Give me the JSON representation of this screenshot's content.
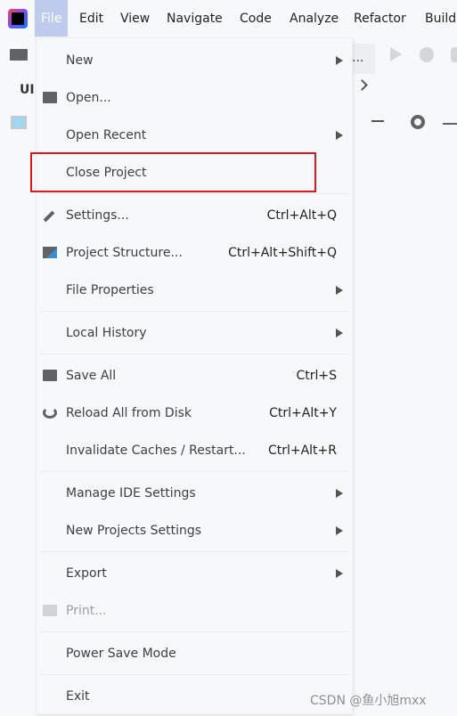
{
  "menubar": {
    "items": [
      {
        "label": "File",
        "mnemonic": "F",
        "active": true
      },
      {
        "label": "Edit",
        "mnemonic": "E"
      },
      {
        "label": "View",
        "mnemonic": "V"
      },
      {
        "label": "Navigate",
        "mnemonic": "N"
      },
      {
        "label": "Code",
        "mnemonic": "C"
      },
      {
        "label": "Analyze",
        "mnemonic": "z"
      },
      {
        "label": "Refactor",
        "mnemonic": "R"
      },
      {
        "label": "Build",
        "mnemonic": "B"
      }
    ]
  },
  "background": {
    "tab_label": "UI",
    "ellipsis": "..."
  },
  "file_menu": {
    "items": [
      {
        "label": "New",
        "mnemonic": "N",
        "submenu": true
      },
      {
        "label": "Open...",
        "mnemonic": "O",
        "icon": "folder-open-icon"
      },
      {
        "label": "Open Recent",
        "mnemonic": "R",
        "submenu": true
      },
      {
        "label": "Close Project",
        "mnemonic": "j",
        "highlighted": true
      },
      {
        "separator": true
      },
      {
        "label": "Settings...",
        "mnemonic": "t",
        "icon": "wrench-icon",
        "shortcut": "Ctrl+Alt+Q"
      },
      {
        "label": "Project Structure...",
        "icon": "project-structure-icon",
        "shortcut": "Ctrl+Alt+Shift+Q"
      },
      {
        "label": "File Properties",
        "submenu": true
      },
      {
        "separator": true
      },
      {
        "label": "Local History",
        "mnemonic": "H",
        "submenu": true
      },
      {
        "separator": true
      },
      {
        "label": "Save All",
        "mnemonic": "S",
        "icon": "save-icon",
        "shortcut": "Ctrl+S"
      },
      {
        "label": "Reload All from Disk",
        "icon": "reload-icon",
        "shortcut": "Ctrl+Alt+Y"
      },
      {
        "label": "Invalidate Caches / Restart...",
        "shortcut": "Ctrl+Alt+R"
      },
      {
        "separator": true
      },
      {
        "label": "Manage IDE Settings",
        "submenu": true
      },
      {
        "label": "New Projects Settings",
        "submenu": true
      },
      {
        "separator": true
      },
      {
        "label": "Export",
        "submenu": true
      },
      {
        "label": "Print...",
        "mnemonic": "P",
        "icon": "print-icon",
        "disabled": true
      },
      {
        "separator": true
      },
      {
        "label": "Power Save Mode"
      },
      {
        "separator": true
      },
      {
        "label": "Exit",
        "mnemonic": "x"
      }
    ]
  },
  "highlight_color": "#e3161c",
  "watermark": "CSDN @鱼小旭mxx"
}
